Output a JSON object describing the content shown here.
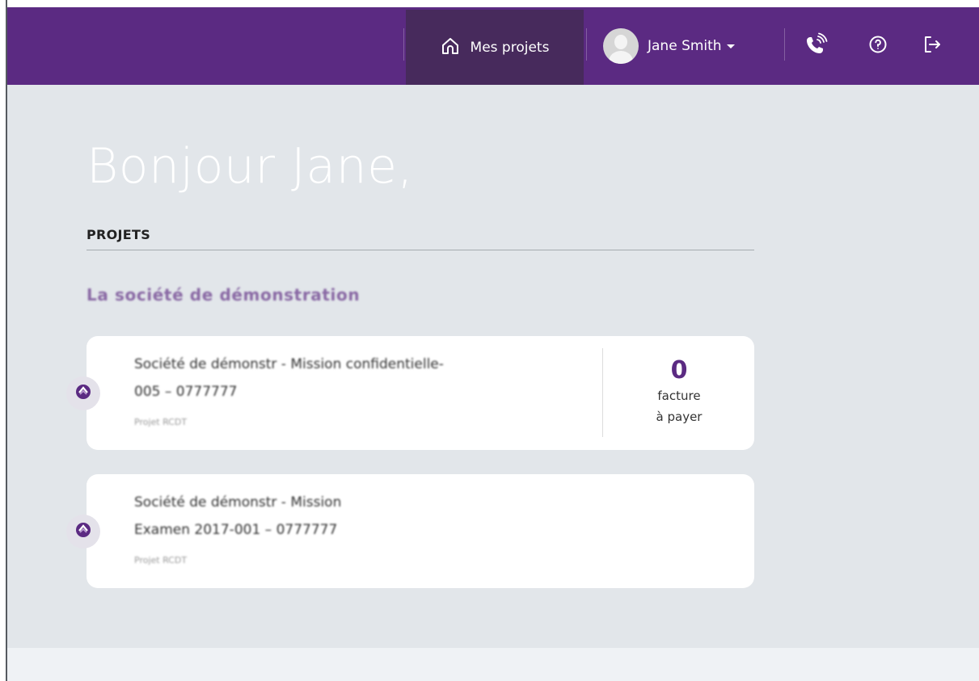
{
  "header": {
    "home_label": "Mes projets",
    "user_name": "Jane Smith",
    "icons": [
      "home-icon",
      "user-avatar",
      "phone-icon",
      "help-icon",
      "logout-icon"
    ]
  },
  "main": {
    "greeting": "Bonjour Jane,",
    "section_title": "PROJETS",
    "company_name": "La société de démonstration",
    "projects": [
      {
        "title_line1": "Société de démonstr - Mission confidentielle-",
        "title_line2": "005 – 0777777",
        "subtitle": "Projet RCDT",
        "invoice_count": "0",
        "invoice_label_line1": "facture",
        "invoice_label_line2": "à payer"
      },
      {
        "title_line1": "Société de démonstr - Mission",
        "title_line2": "Examen 2017-001 – 0777777",
        "subtitle": "Projet RCDT"
      }
    ]
  },
  "colors": {
    "brand_purple": "#5b2a82",
    "nav_active": "#472a5c",
    "page_bg": "#e2e6ea"
  }
}
